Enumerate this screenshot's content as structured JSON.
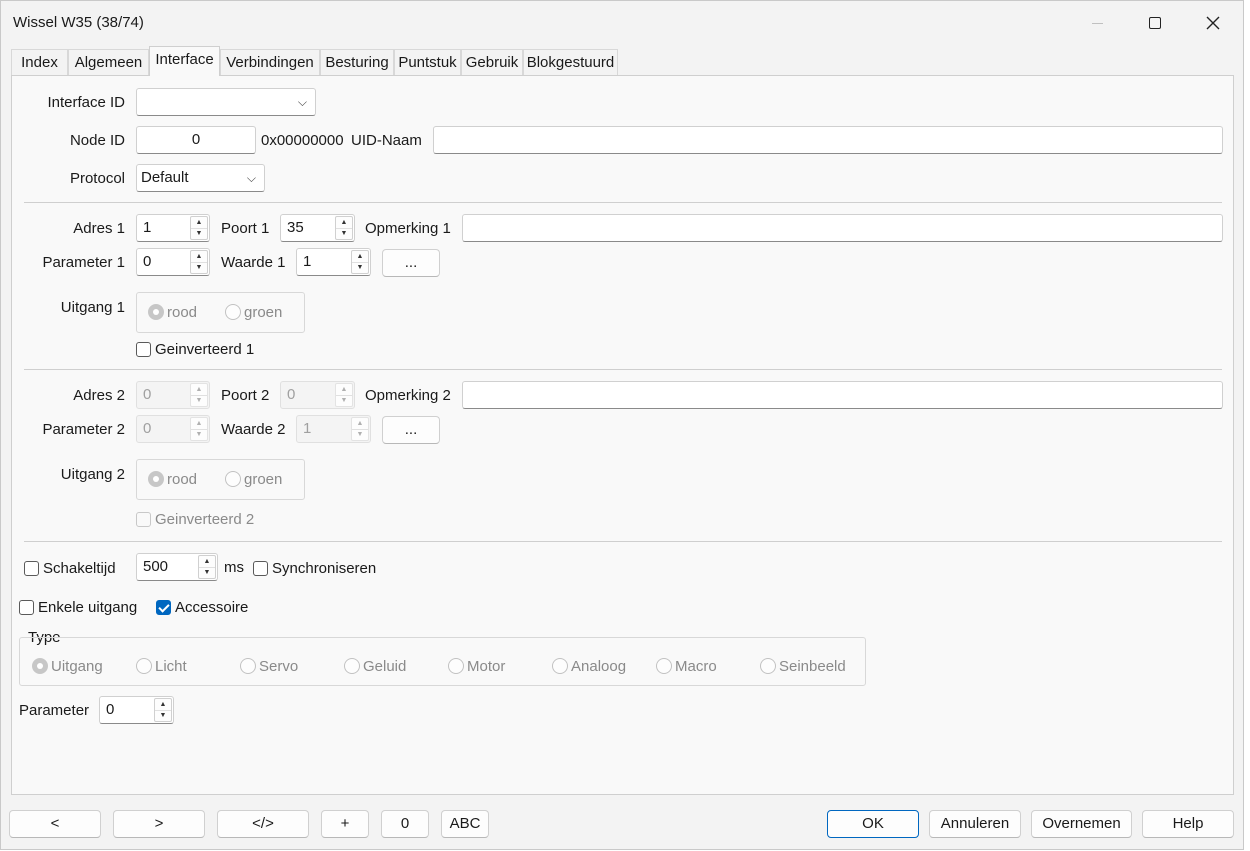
{
  "window": {
    "title": "Wissel W35 (38/74)"
  },
  "tabs": [
    "Index",
    "Algemeen",
    "Interface",
    "Verbindingen",
    "Besturing",
    "Puntstuk",
    "Gebruik",
    "Blokgestuurd"
  ],
  "interface": {
    "interface_id_label": "Interface ID",
    "interface_id_value": "",
    "node_id_label": "Node ID",
    "node_id_value": "0",
    "node_hex": "0x00000000",
    "uid_label": "UID-Naam",
    "uid_value": "",
    "protocol_label": "Protocol",
    "protocol_value": "Default"
  },
  "output1": {
    "adres_label": "Adres 1",
    "adres_value": "1",
    "poort_label": "Poort 1",
    "poort_value": "35",
    "opmerking_label": "Opmerking 1",
    "opmerking_value": "",
    "parameter_label": "Parameter 1",
    "parameter_value": "0",
    "waarde_label": "Waarde 1",
    "waarde_value": "1",
    "more_label": "...",
    "uitgang_label": "Uitgang 1",
    "rood": "rood",
    "groen": "groen",
    "inverted_label": "Geinverteerd 1"
  },
  "output2": {
    "adres_label": "Adres 2",
    "adres_value": "0",
    "poort_label": "Poort 2",
    "poort_value": "0",
    "opmerking_label": "Opmerking 2",
    "opmerking_value": "",
    "parameter_label": "Parameter 2",
    "parameter_value": "0",
    "waarde_label": "Waarde 2",
    "waarde_value": "1",
    "more_label": "...",
    "uitgang_label": "Uitgang 2",
    "rood": "rood",
    "groen": "groen",
    "inverted_label": "Geinverteerd 2"
  },
  "options": {
    "schakeltijd_label": "Schakeltijd",
    "schakeltijd_value": "500",
    "ms_label": "ms",
    "sync_label": "Synchroniseren",
    "enkele_label": "Enkele uitgang",
    "accessoire_label": "Accessoire"
  },
  "type": {
    "label": "Type",
    "options": [
      "Uitgang",
      "Licht",
      "Servo",
      "Geluid",
      "Motor",
      "Analoog",
      "Macro",
      "Seinbeeld"
    ]
  },
  "parameter": {
    "label": "Parameter",
    "value": "0"
  },
  "buttons": {
    "prev": "<",
    "next": ">",
    "code": "</>",
    "add": "+",
    "zero": "0",
    "abc": "ABC",
    "ok": "OK",
    "cancel": "Annuleren",
    "apply": "Overnemen",
    "help": "Help"
  },
  "colors": {
    "accent": "#0067c0",
    "disabled_text": "#8a8a8a"
  }
}
